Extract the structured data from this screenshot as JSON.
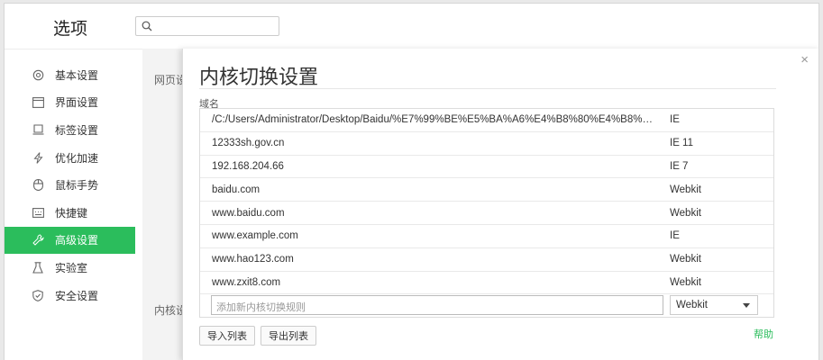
{
  "header": {
    "title": "选项",
    "search_placeholder": ""
  },
  "sidebar": {
    "items": [
      {
        "label": "基本设置",
        "icon": "gear-icon"
      },
      {
        "label": "界面设置",
        "icon": "window-icon"
      },
      {
        "label": "标签设置",
        "icon": "tag-icon"
      },
      {
        "label": "优化加速",
        "icon": "lightning-icon"
      },
      {
        "label": "鼠标手势",
        "icon": "mouse-icon"
      },
      {
        "label": "快捷键",
        "icon": "keyboard-icon"
      },
      {
        "label": "高级设置",
        "icon": "wrench-icon",
        "active": true
      },
      {
        "label": "实验室",
        "icon": "flask-icon"
      },
      {
        "label": "安全设置",
        "icon": "shield-icon"
      }
    ]
  },
  "background_labels": {
    "web": "网页设",
    "kernel": "内核设"
  },
  "dialog": {
    "title": "内核切换设置",
    "column_label": "域名",
    "rows": [
      {
        "domain": "/C:/Users/Administrator/Desktop/Baidu/%E7%99%BE%E5%BA%A6%E4%B8%80%E4%B8%8B%EF...",
        "engine": "IE"
      },
      {
        "domain": "12333sh.gov.cn",
        "engine": "IE 11"
      },
      {
        "domain": "192.168.204.66",
        "engine": "IE 7"
      },
      {
        "domain": "baidu.com",
        "engine": "Webkit"
      },
      {
        "domain": "www.baidu.com",
        "engine": "Webkit"
      },
      {
        "domain": "www.example.com",
        "engine": "IE"
      },
      {
        "domain": "www.hao123.com",
        "engine": "Webkit"
      },
      {
        "domain": "www.zxit8.com",
        "engine": "Webkit"
      }
    ],
    "new_rule_placeholder": "添加新内核切换规则",
    "engine_select_value": "Webkit",
    "import_label": "导入列表",
    "export_label": "导出列表",
    "help_label": "帮助",
    "close_glyph": "×"
  },
  "colors": {
    "accent": "#2bbd5c"
  }
}
